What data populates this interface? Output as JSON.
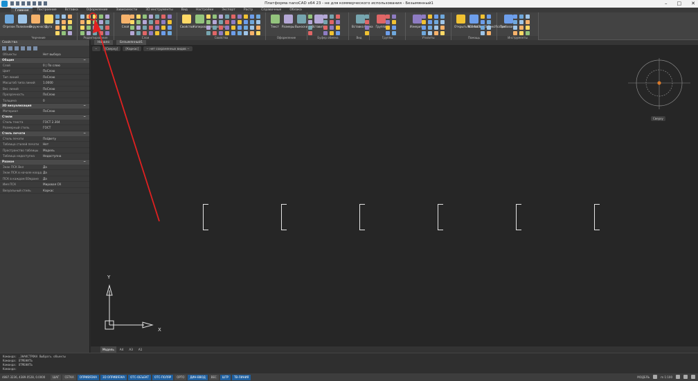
{
  "window": {
    "title": "Платформа nanoCAD x64 23 - не для коммерческого использования - Безымянный1"
  },
  "ribbon_tabs": [
    "Главная",
    "Построение",
    "Вставка",
    "Оформление",
    "Зависимости",
    "3D инструменты",
    "Вид",
    "Настройки",
    "Экспорт",
    "Растр",
    "Справочные",
    "Облака"
  ],
  "ribbon_groups": [
    {
      "label": "Черчение",
      "buttons": [
        "Отрезок",
        "Полилиния",
        "Окружность",
        "Дуга"
      ]
    },
    {
      "label": "Редактирование",
      "buttons": []
    },
    {
      "label": "Слои",
      "buttons": [
        "Слой"
      ]
    },
    {
      "label": "Свойства",
      "buttons": [
        "Свойства",
        "Копирование свойств"
      ]
    },
    {
      "label": "Оформление",
      "buttons": [
        "Текст",
        "Размеры",
        "Выноски"
      ]
    },
    {
      "label": "Буфер обмена",
      "buttons": [
        "Вставить"
      ]
    },
    {
      "label": "Вид",
      "buttons": [
        "Вставка блока"
      ]
    },
    {
      "label": "Группы",
      "buttons": [
        "Группа"
      ]
    },
    {
      "label": "Утилиты",
      "buttons": [
        "Измерить"
      ]
    },
    {
      "label": "Помощь",
      "buttons": [
        "Открыть NormaCS",
        "NCS NormaCS Specification"
      ]
    },
    {
      "label": "Инструменты",
      "buttons": [
        "Требования"
      ]
    }
  ],
  "properties_panel": {
    "header": "Свойства",
    "selection": {
      "k": "Объекты",
      "v": "Нет выбора"
    },
    "sections": [
      {
        "title": "Общие",
        "rows": [
          {
            "k": "Слой",
            "v": "0 | По слою"
          },
          {
            "k": "Цвет",
            "v": "ПоСлою"
          },
          {
            "k": "Тип линий",
            "v": "ПоСлою"
          },
          {
            "k": "Масштаб типа линий",
            "v": "1.0000"
          },
          {
            "k": "Вес линий",
            "v": "ПоСлою"
          },
          {
            "k": "Прозрачность",
            "v": "ПоСлою"
          },
          {
            "k": "Толщина",
            "v": "0"
          }
        ]
      },
      {
        "title": "3D визуализация",
        "rows": [
          {
            "k": "Материал",
            "v": "ПоСлою"
          }
        ]
      },
      {
        "title": "Стили",
        "rows": [
          {
            "k": "Стиль текста",
            "v": "ГОСТ 2.304"
          },
          {
            "k": "Размерный стиль",
            "v": "ГОСТ"
          }
        ]
      },
      {
        "title": "Стиль печати",
        "rows": [
          {
            "k": "Стиль печати",
            "v": "ПоЦвету"
          },
          {
            "k": "Таблица стилей печати",
            "v": "Нет"
          },
          {
            "k": "Пространство таблицы",
            "v": "Модель"
          },
          {
            "k": "Таблица недоступна",
            "v": "Недоступна"
          }
        ]
      },
      {
        "title": "Разное",
        "rows": [
          {
            "k": "Знак ПСК Вкл",
            "v": "Да"
          },
          {
            "k": "Знак ПСК в начале коорд.",
            "v": "Да"
          },
          {
            "k": "ПСК в каждом ВЭкране",
            "v": "Да"
          },
          {
            "k": "Имя ПСК",
            "v": "Мировая СК"
          },
          {
            "k": "Визуальный стиль",
            "v": "Каркас"
          }
        ]
      }
    ]
  },
  "doc_tabs": [
    "Начало",
    "Безымянный1"
  ],
  "view_controls": [
    "−",
    "[Сверху]",
    "[Каркас]",
    "− нет сохраненных видов −"
  ],
  "compass": {
    "label": "Сверху"
  },
  "ucs": {
    "x_label": "X",
    "y_label": "Y"
  },
  "layout_tabs": [
    "Модель",
    "А4",
    "А3",
    "А1"
  ],
  "command_lines": [
    "Команда: _ЗНАКСТРОКА  Выбрать объекты",
    "Команда: ОТМЕНИТЬ",
    "Команда:  ОТМЕНИТЬ",
    "Команда:"
  ],
  "status": {
    "coords": "4887.3236, 4389.0528, 0.0000",
    "toggles": [
      {
        "t": "ШАГ",
        "on": false
      },
      {
        "t": "СЕТКА",
        "on": false
      },
      {
        "t": "ОПРИВЯЗКА",
        "on": true
      },
      {
        "t": "3D ОПРИВЯЗКА",
        "on": true
      },
      {
        "t": "ОТС-ОБЪЕКТ",
        "on": true
      },
      {
        "t": "ОТС-ПОЛЯР",
        "on": true
      },
      {
        "t": "ОРТО",
        "on": false
      },
      {
        "t": "ДИН-ВВОД",
        "on": true
      },
      {
        "t": "ВЕС",
        "on": false
      },
      {
        "t": "ШТР",
        "on": true
      },
      {
        "t": "ТВ-ЛИНИЯ",
        "on": true
      }
    ],
    "right": {
      "model": "МОДЕЛЬ",
      "scale": "m 1:100"
    }
  },
  "colors": {
    "accent": "#1f5f9e",
    "annotation_arrow": "#e02020",
    "ucs": "#e6e6e6",
    "compass_dot": "#d97a2a"
  },
  "drawing": {
    "bracket_count": 6
  },
  "annotation": {
    "type": "arrow",
    "target": "ribbon-rotate-tool",
    "color": "#e02020"
  }
}
